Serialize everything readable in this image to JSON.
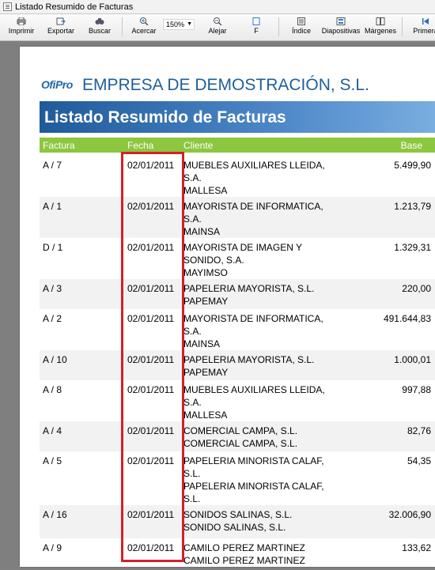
{
  "window": {
    "title": "Listado Resumido de Facturas"
  },
  "toolbar": {
    "print": "Imprimir",
    "export": "Exportar",
    "search": "Buscar",
    "zoom_in": "Acercar",
    "zoom_value": "150%",
    "zoom_out": "Alejar",
    "fit": "F",
    "index": "Índice",
    "slides": "Diapositivas",
    "margins": "Márgenes",
    "first": "Primera"
  },
  "report": {
    "logo": "OfiPro",
    "company": "EMPRESA DE DEMOSTRACIÓN, S.L.",
    "title": "Listado Resumido de Facturas",
    "columns": {
      "factura": "Factura",
      "fecha": "Fecha",
      "cliente": "Cliente",
      "base": "Base"
    },
    "rows": [
      {
        "factura": "A / 7",
        "fecha": "02/01/2011",
        "cliente1": "MUEBLES AUXILIARES LLEIDA, S.A.",
        "cliente2": "MALLESA",
        "base": "5.499,90"
      },
      {
        "factura": "A / 1",
        "fecha": "02/01/2011",
        "cliente1": "MAYORISTA DE INFORMATICA, S.A.",
        "cliente2": "MAINSA",
        "base": "1.213,79"
      },
      {
        "factura": "D / 1",
        "fecha": "02/01/2011",
        "cliente1": "MAYORISTA DE IMAGEN Y SONIDO, S.A.",
        "cliente2": "MAYIMSO",
        "base": "1.329,31"
      },
      {
        "factura": "A / 3",
        "fecha": "02/01/2011",
        "cliente1": "PAPELERIA MAYORISTA, S.L.",
        "cliente2": "PAPEMAY",
        "base": "220,00"
      },
      {
        "factura": "A / 2",
        "fecha": "02/01/2011",
        "cliente1": "MAYORISTA DE INFORMATICA, S.A.",
        "cliente2": "MAINSA",
        "base": "491.644,83"
      },
      {
        "factura": "A / 10",
        "fecha": "02/01/2011",
        "cliente1": "PAPELERIA MAYORISTA, S.L.",
        "cliente2": "PAPEMAY",
        "base": "1.000,01"
      },
      {
        "factura": "A / 8",
        "fecha": "02/01/2011",
        "cliente1": "MUEBLES AUXILIARES LLEIDA, S.A.",
        "cliente2": "MALLESA",
        "base": "997,88"
      },
      {
        "factura": "A / 4",
        "fecha": "02/01/2011",
        "cliente1": "COMERCIAL CAMPA, S.L.",
        "cliente2": "COMERCIAL CAMPA, S.L.",
        "base": "82,76"
      },
      {
        "factura": "A / 5",
        "fecha": "02/01/2011",
        "cliente1": "PAPELERIA MINORISTA CALAF, S.L.",
        "cliente2": "PAPELERIA MINORISTA CALAF, S.L.",
        "base": "54,35"
      },
      {
        "factura": "A / 16",
        "fecha": "02/01/2011",
        "cliente1": "SONIDOS SALINAS, S.L.",
        "cliente2": "SONIDO SALINAS, S.L.",
        "base": "32.006,90"
      },
      {
        "factura": "A / 9",
        "fecha": "02/01/2011",
        "cliente1": "CAMILO PEREZ MARTINEZ",
        "cliente2": "CAMILO PEREZ MARTINEZ",
        "base": "133,62"
      }
    ]
  },
  "colors": {
    "accent_green": "#8dc63f",
    "banner_blue": "#1f5a9a",
    "highlight_red": "#d42027"
  }
}
